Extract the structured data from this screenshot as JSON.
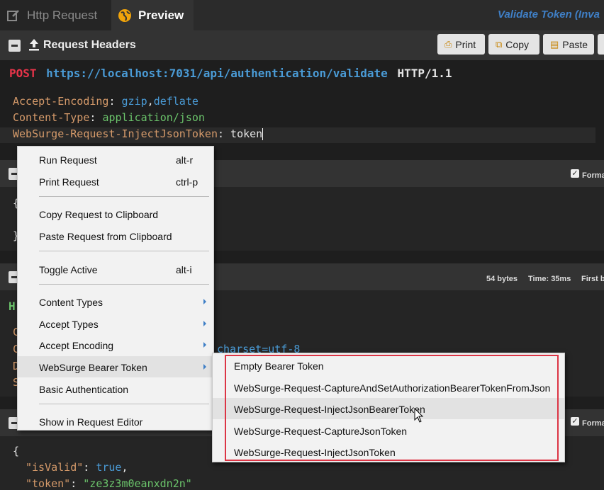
{
  "tabs": {
    "http_request": "Http Request",
    "preview": "Preview",
    "title": "Validate Token (Inva"
  },
  "request_headers": {
    "title": "Request Headers",
    "print": "Print",
    "copy": "Copy",
    "paste": "Paste"
  },
  "request": {
    "method": "POST",
    "url": "https://localhost:7031/api/authentication/validate",
    "protocol": "HTTP/1.1",
    "headers": [
      {
        "key": "Accept-Encoding",
        "value_a": "gzip",
        "comma": ",",
        "value_b": "deflate"
      },
      {
        "key": "Content-Type",
        "value": "application/json"
      },
      {
        "key": "WebSurge-Request-InjectJsonToken",
        "value": "token"
      }
    ]
  },
  "request_body": {
    "open": "{",
    "close": "}",
    "format_label": "Forma"
  },
  "response": {
    "size": "54 bytes",
    "time": "Time: 35ms",
    "first": "First by",
    "status_prefix": "H",
    "header_prefixes": [
      "C",
      "C",
      "D",
      "S"
    ],
    "charset_fragment": "charset=utf-8"
  },
  "response_body": {
    "format_label": "Forma",
    "open": "{",
    "lines": [
      {
        "key": "\"isValid\"",
        "value": "true",
        "comma": ","
      },
      {
        "key": "\"token\"",
        "value": "\"ze3z3m0eanxdn2n\""
      }
    ]
  },
  "context_menu": {
    "items": [
      {
        "label": "Run Request",
        "shortcut": "alt-r"
      },
      {
        "label": "Print Request",
        "shortcut": "ctrl-p"
      },
      {
        "label": "Copy Request to Clipboard"
      },
      {
        "label": "Paste Request from Clipboard"
      },
      {
        "label": "Toggle Active",
        "shortcut": "alt-i"
      },
      {
        "label": "Content Types"
      },
      {
        "label": "Accept Types"
      },
      {
        "label": "Accept Encoding"
      },
      {
        "label": "WebSurge Bearer Token"
      },
      {
        "label": "Basic Authentication"
      },
      {
        "label": "Show in Request Editor"
      }
    ]
  },
  "submenu": {
    "items": [
      "Empty Bearer Token",
      "WebSurge-Request-CaptureAndSetAuthorizationBearerTokenFromJson",
      "WebSurge-Request-InjectJsonBearerToken",
      "WebSurge-Request-CaptureJsonToken",
      "WebSurge-Request-InjectJsonToken"
    ]
  },
  "colors": {
    "accent": "#3f7fc6",
    "method": "#e8344a",
    "header_key": "#d59a6a",
    "header_value": "#4a9bd6",
    "highlight_box": "#dc3545"
  },
  "icons": [
    "edit-icon",
    "globe-icon",
    "upload-icon",
    "print-icon",
    "copy-icon",
    "paste-icon",
    "collapse-icon",
    "mouse-cursor-icon"
  ]
}
